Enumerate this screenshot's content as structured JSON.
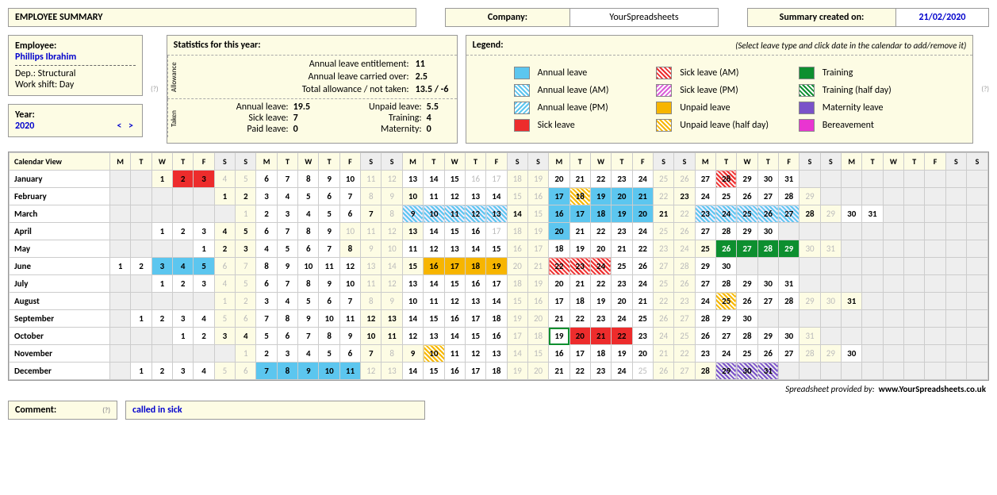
{
  "title": "EMPLOYEE SUMMARY",
  "company_label": "Company:",
  "company": "YourSpreadsheets",
  "created_label": "Summary created on:",
  "created": "21/02/2020",
  "employee": {
    "label": "Employee:",
    "name": "Phillips Ibrahim",
    "dep": "Dep.: Structural",
    "shift": "Work shift: Day"
  },
  "year": {
    "label": "Year:",
    "value": "2020",
    "prev": "<",
    "next": ">"
  },
  "stats": {
    "title": "Statistics for this year:",
    "allowance_label": "Allowance",
    "taken_label": "Taken",
    "entitlement_l": "Annual leave entitlement:",
    "entitlement_v": "11",
    "carried_l": "Annual leave carried over:",
    "carried_v": "2.5",
    "total_l": "Total allowance / not taken:",
    "total_v": "13.5 / -6",
    "annual_l": "Annual leave:",
    "annual_v": "19.5",
    "unpaid_l": "Unpaid leave:",
    "unpaid_v": "5.5",
    "sick_l": "Sick leave:",
    "sick_v": "7",
    "training_l": "Training:",
    "training_v": "4",
    "paid_l": "Paid leave:",
    "paid_v": "0",
    "maternity_l": "Maternity:",
    "maternity_v": "0"
  },
  "legend": {
    "title": "Legend:",
    "hint": "(Select leave type and click date in the calendar to add/remove it)",
    "items": [
      "Annual leave",
      "Sick leave (AM)",
      "Training",
      "Annual leave (AM)",
      "Sick leave (PM)",
      "Training (half day)",
      "Annual leave (PM)",
      "Unpaid leave",
      "Maternity leave",
      "Sick leave",
      "Unpaid leave (half day)",
      "Bereavement"
    ]
  },
  "calendar": {
    "title": "Calendar View",
    "dow": [
      "M",
      "T",
      "W",
      "T",
      "F",
      "S",
      "S",
      "M",
      "T",
      "W",
      "T",
      "F",
      "S",
      "S",
      "M",
      "T",
      "W",
      "T",
      "F",
      "S",
      "S",
      "M",
      "T",
      "W",
      "T",
      "F",
      "S",
      "S",
      "M",
      "T",
      "W",
      "T",
      "F",
      "S",
      "S",
      "M",
      "T",
      "W",
      "T",
      "F",
      "S",
      "S"
    ],
    "months": [
      "January",
      "February",
      "March",
      "April",
      "May",
      "June",
      "July",
      "August",
      "September",
      "October",
      "November",
      "December"
    ],
    "month_start_col": [
      2,
      5,
      6,
      2,
      4,
      0,
      2,
      5,
      1,
      3,
      6,
      1
    ],
    "month_len": [
      31,
      29,
      31,
      30,
      31,
      30,
      31,
      31,
      30,
      31,
      30,
      31
    ],
    "grey_days": {
      "0": [
        11,
        12,
        16,
        17,
        18,
        19,
        25,
        26
      ],
      "1": [
        8,
        9,
        15,
        16,
        22,
        29
      ],
      "2": [
        1,
        8,
        15,
        22,
        29
      ],
      "3": [
        10,
        11,
        12,
        17,
        18,
        19,
        25,
        26
      ],
      "4": [
        9,
        10,
        16,
        17,
        23,
        24,
        30,
        31
      ],
      "5": [
        6,
        7,
        13,
        14,
        20,
        21,
        27,
        28
      ],
      "6": [
        4,
        5,
        11,
        12,
        18,
        19,
        25,
        26
      ],
      "7": [
        1,
        2,
        8,
        9,
        15,
        16,
        22,
        23,
        29,
        30
      ],
      "8": [
        5,
        6,
        19,
        20,
        26,
        27
      ],
      "9": [
        17,
        18,
        24,
        25,
        31
      ],
      "10": [
        1,
        8,
        14,
        15,
        21,
        22,
        28,
        29
      ],
      "11": [
        5,
        6,
        12,
        13,
        19,
        20,
        25,
        26,
        27
      ]
    },
    "leave": {
      "0": {
        "1": "wkend",
        "2": "sick",
        "3": "sick",
        "4": "grey",
        "5": "grey",
        "28": "sick-am"
      },
      "1": {
        "10": "wkend",
        "17": "annual",
        "18": "unpaid-h",
        "19": "annual",
        "20": "annual",
        "21": "annual"
      },
      "2": {
        "9": "annual-am",
        "10": "annual-am",
        "11": "annual-am",
        "12": "annual-am",
        "13": "annual-am",
        "16": "annual",
        "17": "annual",
        "18": "annual",
        "19": "annual",
        "20": "annual",
        "23": "annual-am",
        "24": "annual-am",
        "25": "annual-am",
        "26": "annual-am",
        "27": "annual-am"
      },
      "3": {
        "10": "wkend",
        "13": "wkend",
        "20": "annual"
      },
      "4": {
        "8": "wkend",
        "25": "wkend",
        "26": "training",
        "27": "training",
        "28": "training",
        "29": "training"
      },
      "5": {
        "3": "annual",
        "4": "annual",
        "5": "annual",
        "15": "wkend",
        "16": "unpaid",
        "17": "unpaid",
        "18": "unpaid",
        "19": "unpaid",
        "22": "sick-am",
        "23": "sick-am",
        "24": "sick-am"
      },
      "6": {},
      "7": {
        "25": "unpaid-h",
        "31": "wkend"
      },
      "8": {},
      "9": {
        "20": "sick",
        "21": "sick",
        "22": "sick",
        "19": "sel"
      },
      "10": {
        "9": "wkend",
        "10": "unpaid-h"
      },
      "11": {
        "7": "annual",
        "8": "annual",
        "9": "annual",
        "10": "annual",
        "11": "annual",
        "28": "wkend",
        "29": "maternity",
        "30": "maternity",
        "31": "maternity"
      }
    }
  },
  "footer": {
    "provided": "Spreadsheet provided by:",
    "url": "www.YourSpreadsheets.co.uk"
  },
  "comment": {
    "label": "Comment:",
    "value": "called in sick"
  },
  "help": "(?)"
}
